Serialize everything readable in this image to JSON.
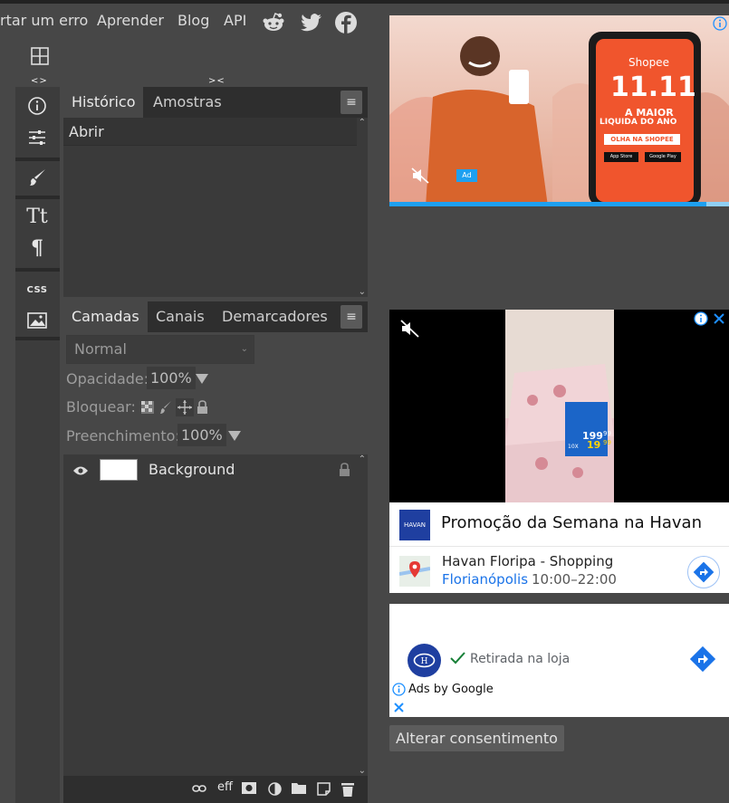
{
  "nav": {
    "links": [
      "rtar um erro",
      "Aprender",
      "Blog",
      "API"
    ],
    "social_icons": [
      "reddit-icon",
      "twitter-icon",
      "facebook-icon"
    ]
  },
  "handles": {
    "left": "<>",
    "right": "><"
  },
  "tools": {
    "groups": [
      [
        "info-icon",
        "adjustments-icon"
      ],
      [
        "brush-icon"
      ],
      [
        "text-icon",
        "paragraph-icon"
      ],
      [
        "css-icon",
        "image-icon"
      ]
    ],
    "css_label": "CSS",
    "text_glyph": "Tt",
    "paragraph_glyph": "¶"
  },
  "history_panel": {
    "tabs": [
      "Histórico",
      "Amostras"
    ],
    "active_tab": "Histórico",
    "items": [
      "Abrir"
    ]
  },
  "layers_panel": {
    "tabs": [
      "Camadas",
      "Canais",
      "Demarcadores"
    ],
    "active_tab": "Camadas",
    "blend_mode": "Normal",
    "opacity_label": "Opacidade:",
    "opacity_value": "100%",
    "lock_label": "Bloquear:",
    "fill_label": "Preenchimento:",
    "fill_value": "100%",
    "layers": [
      {
        "name": "Background",
        "visible": true,
        "locked": true
      }
    ],
    "bottom_icons": [
      "link-icon",
      "effects-icon",
      "mask-icon",
      "adjustment-layer-icon",
      "folder-icon",
      "new-layer-icon",
      "trash-icon"
    ],
    "effects_label": "eff"
  },
  "ads": {
    "ad1": {
      "brand": "Shopee",
      "big": "11.11",
      "line1": "A MAIOR",
      "line2": "LIQUIDA DO ANO",
      "cta": "OLHA NA SHOPEE",
      "store1": "App Store",
      "store2": "Google Play",
      "ad_label": "Ad"
    },
    "ad2": {
      "title": "Promoção da Semana na Havan",
      "logo_text": "HAVAN",
      "location": "Havan Floripa - Shopping",
      "city": "Florianópolis",
      "hours": "10:00–22:00",
      "price1": "199",
      "price1_cents": "99",
      "price2": "19",
      "price2_cents": "99",
      "prefix2": "10X"
    },
    "ad3": {
      "pickup": "Retirada na loja",
      "ads_by": "Ads by Google"
    }
  },
  "consent_button": "Alterar consentimento",
  "colors": {
    "background": "#474747",
    "panel": "#3a3a3a",
    "accent_blue": "#1a73e8",
    "shopee_orange": "#f0552d",
    "havan_blue": "#1f3fa0"
  }
}
